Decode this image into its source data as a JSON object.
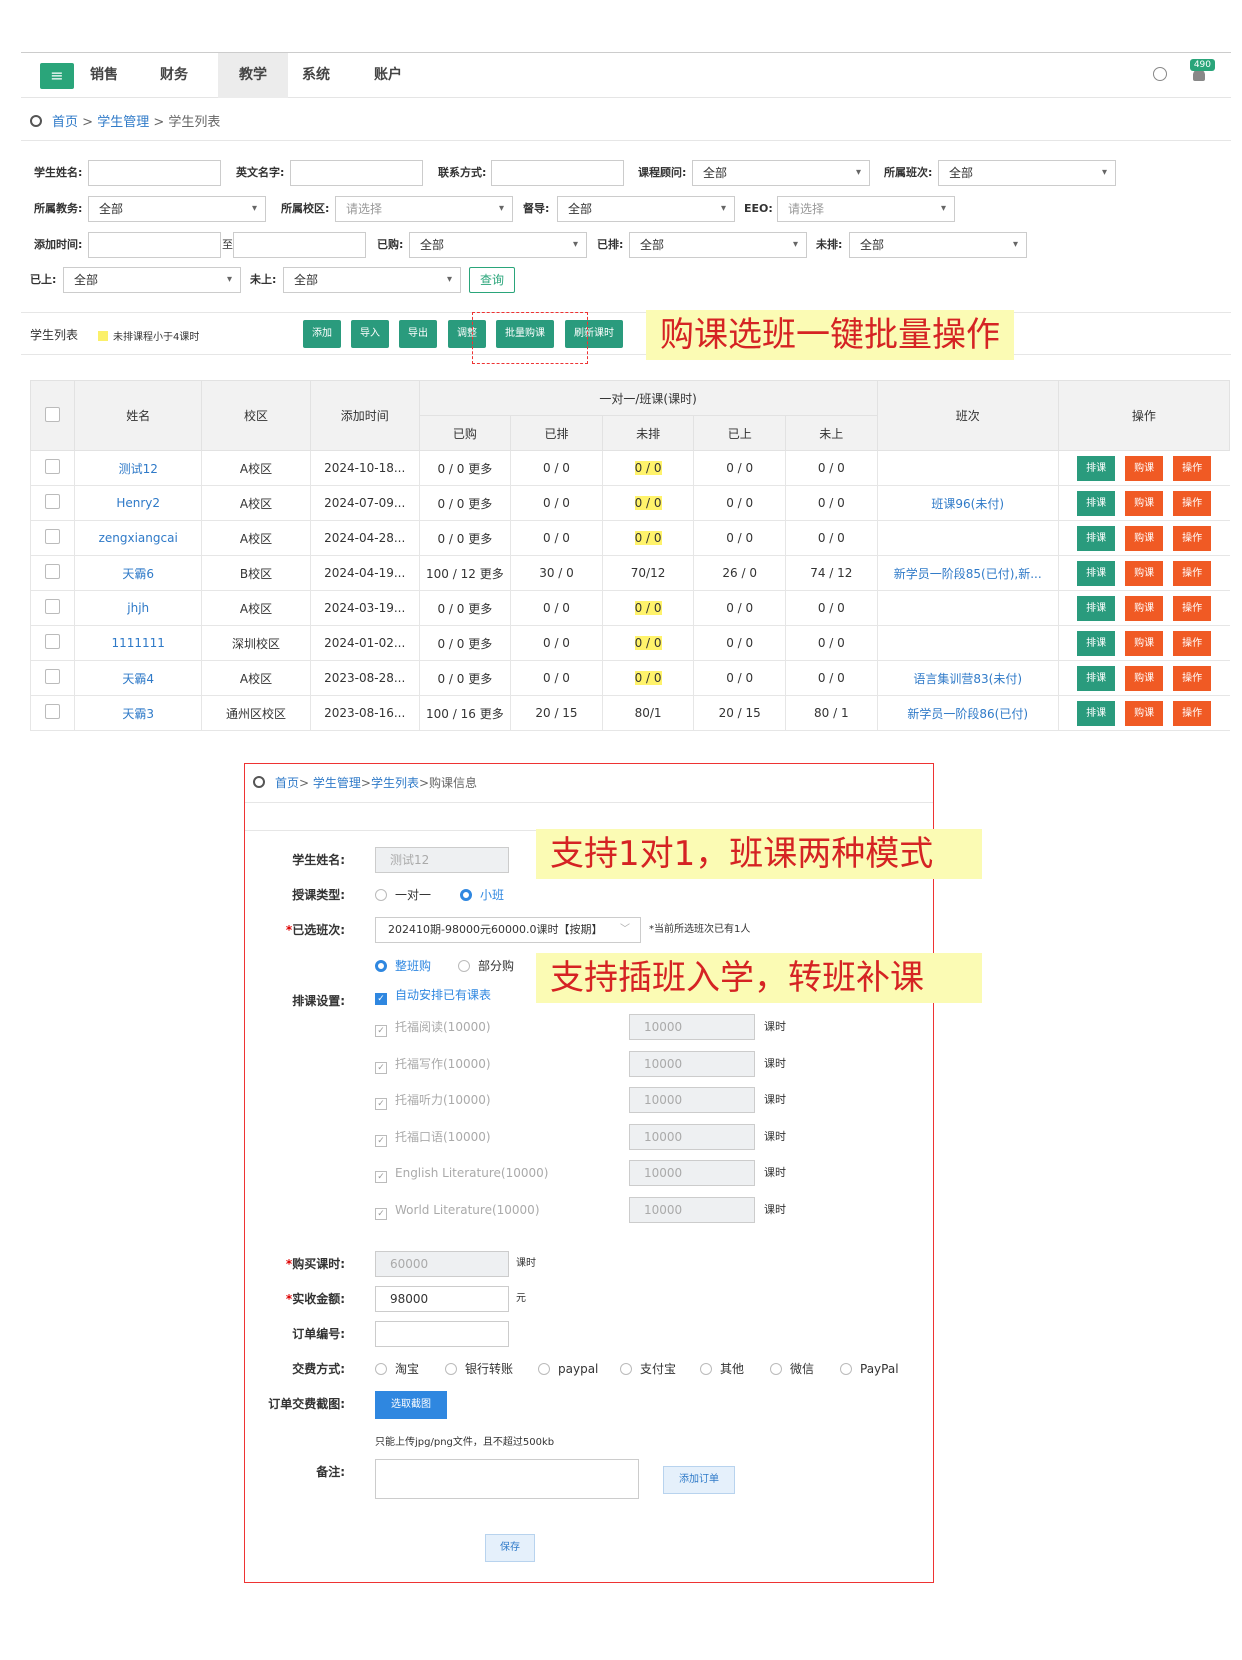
{
  "nav": {
    "tabs": [
      "销售",
      "财务",
      "教学",
      "系统",
      "账户"
    ],
    "badge": "490"
  },
  "breadcrumb": {
    "home": "首页",
    "sep1": " > ",
    "mgmt": "学生管理",
    "sep2": " > ",
    "current": "学生列表"
  },
  "filters": {
    "student_name": "学生姓名:",
    "english_name": "英文名字:",
    "contact": "联系方式:",
    "consultant": "课程顾问:",
    "consultant_val": "全部",
    "class": "所属班次:",
    "class_val": "全部",
    "teacher": "所属教务:",
    "teacher_val": "全部",
    "campus": "所属校区:",
    "campus_ph": "请选择",
    "supervisor": "督导:",
    "supervisor_val": "全部",
    "eeo": "EEO:",
    "eeo_ph": "请选择",
    "add_time": "添加时间:",
    "to": "至",
    "bought": "已购:",
    "bought_val": "全部",
    "scheduled": "已排:",
    "scheduled_val": "全部",
    "unscheduled": "未排:",
    "unscheduled_val": "全部",
    "attended": "已上:",
    "attended_val": "全部",
    "not_attended": "未上:",
    "not_attended_val": "全部",
    "query": "查询"
  },
  "toolbar": {
    "title": "学生列表",
    "legend": "未排课程小于4课时",
    "buttons": [
      "添加",
      "导入",
      "导出",
      "调整",
      "批量购课",
      "刷新课时"
    ],
    "note1": "购课选班一键批量操作"
  },
  "table": {
    "headers": {
      "name": "姓名",
      "campus": "校区",
      "added": "添加时间",
      "group": "一对一/班课(课时)",
      "bought": "已购",
      "scheduled": "已排",
      "unscheduled": "未排",
      "attended": "已上",
      "not_attended": "未上",
      "class": "班次",
      "ops": "操作"
    },
    "more": "更多",
    "op_labels": [
      "排课",
      "购课",
      "操作"
    ],
    "rows": [
      {
        "name": "测试12",
        "campus": "A校区",
        "added": "2024-10-18...",
        "bought": "0 / 0",
        "scheduled": "0 / 0",
        "unscheduled": "0 / 0",
        "attended": "0 / 0",
        "not_attended": "0 / 0",
        "class": "",
        "hl": true
      },
      {
        "name": "Henry2",
        "campus": "A校区",
        "added": "2024-07-09...",
        "bought": "0 / 0",
        "scheduled": "0 / 0",
        "unscheduled": "0 / 0",
        "attended": "0 / 0",
        "not_attended": "0 / 0",
        "class": "班课96(未付)",
        "hl": true
      },
      {
        "name": "zengxiangcai",
        "campus": "A校区",
        "added": "2024-04-28...",
        "bought": "0 / 0",
        "scheduled": "0 / 0",
        "unscheduled": "0 / 0",
        "attended": "0 / 0",
        "not_attended": "0 / 0",
        "class": "",
        "hl": true
      },
      {
        "name": "天霸6",
        "campus": "B校区",
        "added": "2024-04-19...",
        "bought": "100 / 12",
        "scheduled": "30 / 0",
        "unscheduled": "70/12",
        "attended": "26 / 0",
        "not_attended": "74 / 12",
        "class": "新学员一阶段85(已付),新...",
        "hl": false
      },
      {
        "name": "jhjh",
        "campus": "A校区",
        "added": "2024-03-19...",
        "bought": "0 / 0",
        "scheduled": "0 / 0",
        "unscheduled": "0 / 0",
        "attended": "0 / 0",
        "not_attended": "0 / 0",
        "class": "",
        "hl": true
      },
      {
        "name": "1111111",
        "campus": "深圳校区",
        "added": "2024-01-02...",
        "bought": "0 / 0",
        "scheduled": "0 / 0",
        "unscheduled": "0 / 0",
        "attended": "0 / 0",
        "not_attended": "0 / 0",
        "class": "",
        "hl": true
      },
      {
        "name": "天霸4",
        "campus": "A校区",
        "added": "2023-08-28...",
        "bought": "0 / 0",
        "scheduled": "0 / 0",
        "unscheduled": "0 / 0",
        "attended": "0 / 0",
        "not_attended": "0 / 0",
        "class": "语言集训营83(未付)",
        "hl": true
      },
      {
        "name": "天霸3",
        "campus": "通州区校区",
        "added": "2023-08-16...",
        "bought": "100 / 16",
        "scheduled": "20 / 15",
        "unscheduled": "80/1",
        "attended": "20 / 15",
        "not_attended": "80 / 1",
        "class": "新学员一阶段86(已付)",
        "hl": false
      }
    ]
  },
  "form": {
    "breadcrumb": {
      "home": "首页",
      "mgmt": "学生管理",
      "list": "学生列表",
      "current": "购课信息"
    },
    "student_label": "学生姓名:",
    "student_val": "测试12",
    "type_label": "授课类型:",
    "type_one": "一对一",
    "type_class": "小班",
    "class_label": "已选班次:",
    "class_val": "202410期-98000元60000.0课时【按期】",
    "class_hint": "*当前所选班次已有1人",
    "whole": "整班购",
    "part": "部分购",
    "sched_label": "排课设置:",
    "auto": "自动安排已有课表",
    "courses": [
      {
        "name": "托福阅读(10000)",
        "hours": "10000"
      },
      {
        "name": "托福写作(10000)",
        "hours": "10000"
      },
      {
        "name": "托福听力(10000)",
        "hours": "10000"
      },
      {
        "name": "托福口语(10000)",
        "hours": "10000"
      },
      {
        "name": "English Literature(10000)",
        "hours": "10000"
      },
      {
        "name": "World Literature(10000)",
        "hours": "10000"
      }
    ],
    "unit_hours": "课时",
    "buy_label": "购买课时:",
    "buy_val": "60000",
    "pay_label": "实收金额:",
    "pay_val": "98000",
    "yuan": "元",
    "order_label": "订单编号:",
    "method_label": "交费方式:",
    "methods": [
      "淘宝",
      "银行转账",
      "paypal",
      "支付宝",
      "其他",
      "微信",
      "PayPal"
    ],
    "shot_label": "订单交费截图:",
    "shot_btn": "选取截图",
    "shot_hint": "只能上传jpg/png文件，且不超过500kb",
    "remark_label": "备注:",
    "add_order": "添加订单",
    "save": "保存",
    "note2": "支持1对1，班课两种模式",
    "note3": "支持插班入学，转班补课"
  }
}
